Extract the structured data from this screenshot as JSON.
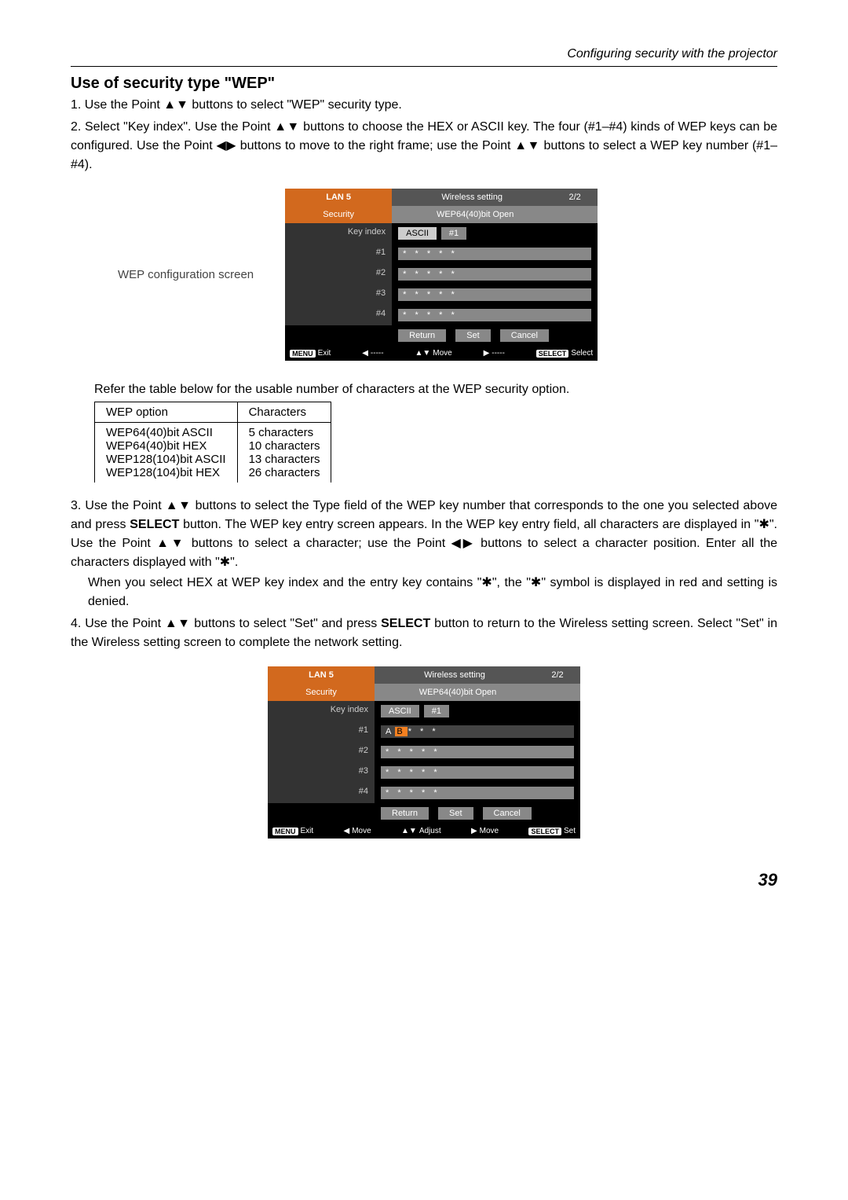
{
  "header": {
    "right": "Configuring security with the projector"
  },
  "title": "Use of security type \"WEP\"",
  "steps": {
    "s1": "1. Use the Point ▲▼ buttons to select \"WEP\" security type.",
    "s2": "2. Select \"Key index\". Use the Point ▲▼ buttons to choose the HEX or ASCII key. The four (#1–#4) kinds of WEP keys can be configured. Use the Point ◀▶ buttons to move to the right frame; use the Point ▲▼ buttons to select a WEP key number (#1–#4).",
    "s3a": "3. Use the Point ▲▼ buttons to select the Type field of the WEP key number that corresponds to the one you selected above and press ",
    "s3b": "SELECT",
    "s3c": " button. The WEP key entry screen appears. In the WEP key entry field, all characters are displayed in \"✱\". Use the Point ▲▼ buttons to select a character; use the Point ◀▶ buttons to select a character position. Enter all the characters displayed with \"✱\".",
    "s3d": "When you select HEX at WEP key index and the entry key contains \"✱\", the \"✱\" symbol is displayed in red and setting is denied.",
    "s4a": "4. Use the Point ▲▼ buttons to select \"Set\" and press ",
    "s4b": "SELECT",
    "s4c": " button to return to the Wireless setting screen. Select \"Set\" in the Wireless setting screen to complete the network setting."
  },
  "caption1": "WEP configuration screen",
  "table_intro": "Refer the table below for the usable number of characters at the WEP security option.",
  "char_table": {
    "headers": [
      "WEP option",
      "Characters"
    ],
    "rows": [
      [
        "WEP64(40)bit ASCII",
        "5 characters"
      ],
      [
        "WEP64(40)bit HEX",
        "10 characters"
      ],
      [
        "WEP128(104)bit ASCII",
        "13 characters"
      ],
      [
        "WEP128(104)bit HEX",
        "26 characters"
      ]
    ]
  },
  "menu1": {
    "lan": "LAN 5",
    "wireless": "Wireless setting",
    "page": "2/2",
    "security": "Security",
    "secval": "WEP64(40)bit Open",
    "keyindex": "Key index",
    "ki_ascii": "ASCII",
    "ki_num": "#1",
    "k1": "#1",
    "k2": "#2",
    "k3": "#3",
    "k4": "#4",
    "masked": "* * * * *",
    "return": "Return",
    "set": "Set",
    "cancel": "Cancel",
    "footer": {
      "menu": "MENU",
      "exit": "Exit",
      "dash": "-----",
      "move": "Move",
      "select_badge": "SELECT",
      "select": "Select"
    }
  },
  "menu2": {
    "k1_field_prefix": "A",
    "k1_field_hi": "B",
    "k1_field_suffix": "* * *",
    "footer": {
      "lmove": "Move",
      "adjust": "Adjust",
      "rmove": "Move",
      "set": "Set"
    }
  },
  "page_number": "39"
}
